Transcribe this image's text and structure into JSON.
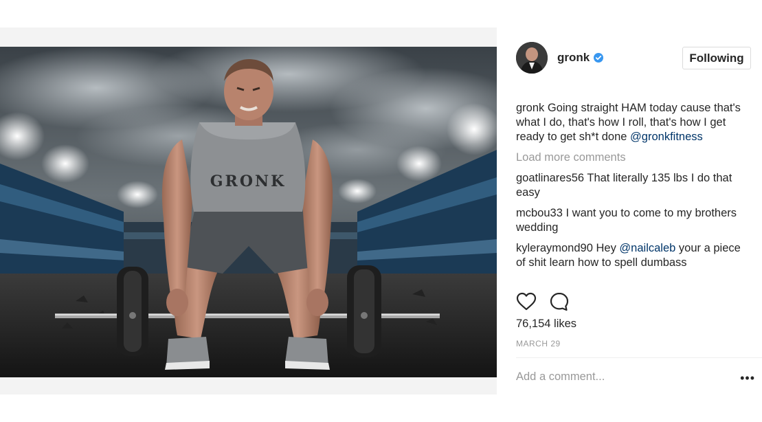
{
  "post": {
    "username": "gronk",
    "follow_label": "Following",
    "caption": {
      "user": "gronk",
      "text": "Going straight HAM today cause that's what I do, that's how I roll, that's how I get ready to get sh*t done",
      "mention": "@gronkfitness"
    },
    "load_more": "Load more comments",
    "comments": [
      {
        "user": "goatlinares56",
        "text": "That literally 135 lbs I do that easy"
      },
      {
        "user": "mcbou33",
        "text": "I want you to come to my brothers wedding"
      },
      {
        "user": "kyleraymond90",
        "pre": "Hey",
        "mention": "@nailcaleb",
        "post": "your a piece of shit learn how to spell dumbass"
      }
    ],
    "likes": "76,154 likes",
    "date": "MARCH 29",
    "add_comment_placeholder": "Add a comment...",
    "more_glyph": "•••",
    "photo_shirt_text": "GRONK"
  },
  "colors": {
    "verified": "#3897f0",
    "mention": "#003569",
    "muted": "#999999"
  },
  "icons": [
    "verified-badge-icon",
    "heart-icon",
    "comment-icon",
    "more-options-icon"
  ]
}
